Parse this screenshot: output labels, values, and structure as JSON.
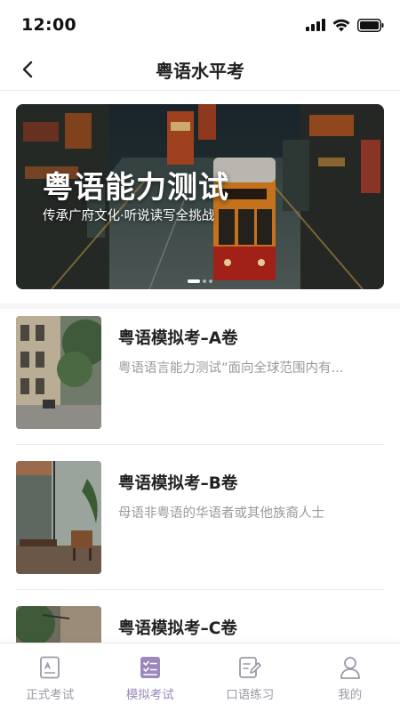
{
  "status": {
    "time": "12:00"
  },
  "nav": {
    "title": "粤语水平考"
  },
  "banner": {
    "title": "粤语能力测试",
    "subtitle": "传承广府文化·听说读写全挑战"
  },
  "exams": [
    {
      "title": "粤语模拟考–A卷",
      "desc": "粤语语言能力测试”面向全球范围内有..."
    },
    {
      "title": "粤语模拟考–B卷",
      "desc": "母语非粤语的华语者或其他族裔人士"
    },
    {
      "title": "粤语模拟考–C卷",
      "desc": ""
    }
  ],
  "tabs": [
    {
      "label": "正式考试",
      "icon": "exam-paper-icon"
    },
    {
      "label": "模拟考试",
      "icon": "checklist-icon"
    },
    {
      "label": "口语练习",
      "icon": "pen-note-icon"
    },
    {
      "label": "我的",
      "icon": "user-icon"
    }
  ],
  "colors": {
    "accent": "#9c88bd",
    "inactive": "#9a9aa6"
  }
}
